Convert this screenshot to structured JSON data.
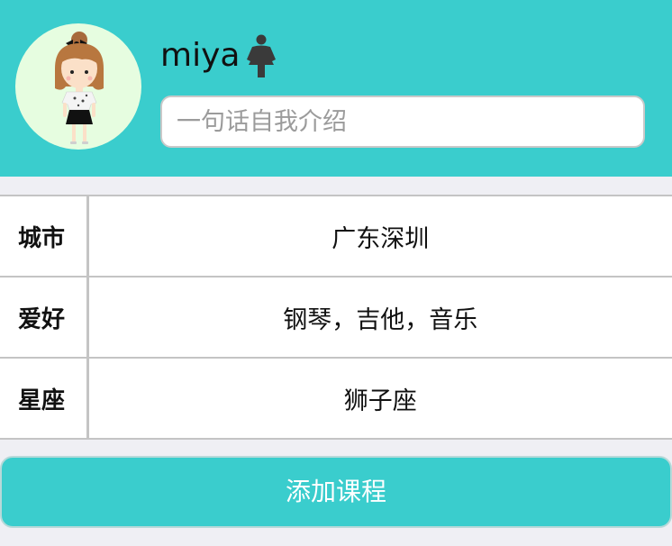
{
  "profile": {
    "username": "miya",
    "intro_placeholder": "一句话自我介绍",
    "avatar_icon": "girl-avatar-icon",
    "gender_icon": "female-icon"
  },
  "info": {
    "rows": [
      {
        "label": "城市",
        "value": "广东深圳"
      },
      {
        "label": "爱好",
        "value": "钢琴，吉他，音乐"
      },
      {
        "label": "星座",
        "value": "狮子座"
      }
    ]
  },
  "actions": {
    "add_course_label": "添加课程"
  },
  "colors": {
    "accent": "#3acdcd",
    "background": "#efeff4",
    "avatar_bg": "#e6fde0"
  }
}
